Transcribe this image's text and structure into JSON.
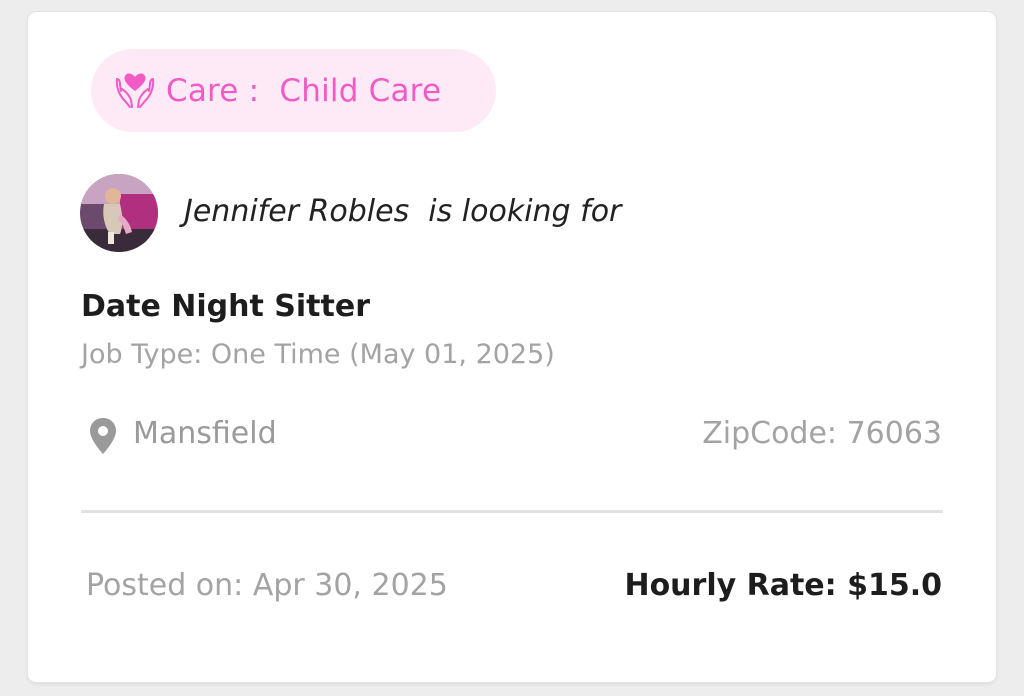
{
  "care_tag": {
    "icon": "heart-hands-icon",
    "label": "Care :  Child Care",
    "color": "#f25bc6",
    "background": "#fdeaf6"
  },
  "poster": {
    "avatar": "user-avatar-photo",
    "text": "Jennifer Robles  is looking for"
  },
  "job": {
    "title": "Date Night Sitter",
    "type_line": "Job Type: One Time (May 01, 2025)"
  },
  "location": {
    "icon": "map-pin-icon",
    "city": "Mansfield",
    "zipcode": "ZipCode: 76063"
  },
  "footer": {
    "posted": "Posted on: Apr 30, 2025",
    "rate": "Hourly Rate: $15.0"
  }
}
